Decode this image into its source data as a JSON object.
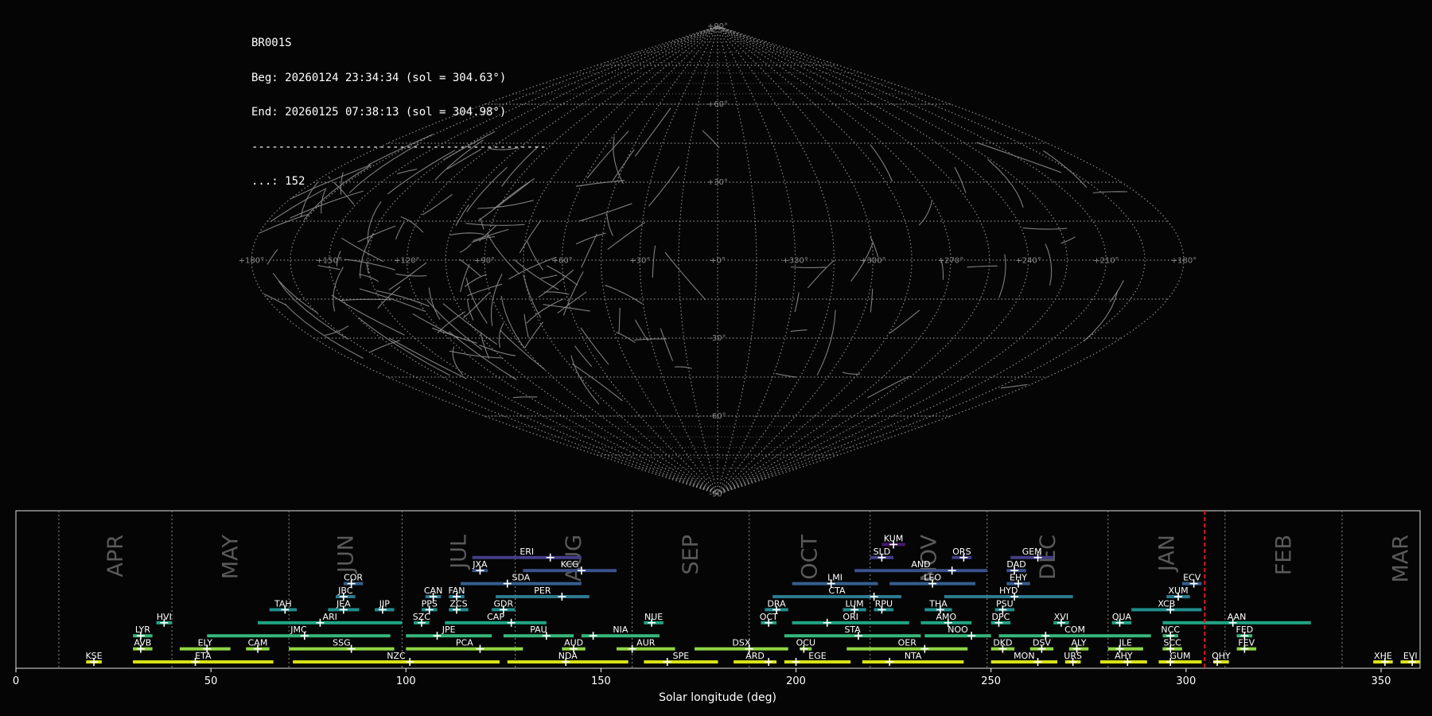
{
  "header": {
    "station": "BR001S",
    "begin": "Beg: 20260124 23:34:34 (sol = 304.63°)",
    "end": "End: 20260125 07:38:13 (sol = 304.98°)",
    "separator": "--------------------------------------------",
    "count": "...: 152"
  },
  "sky_map": {
    "projection": "sinusoidal",
    "lat_labels": [
      "+90°",
      "+60°",
      "+30°",
      "+0°",
      "-30°",
      "-60°",
      "-90°"
    ],
    "lon_labels": [
      "+180°",
      "+150°",
      "+120°",
      "+90°",
      "+60°",
      "+30°",
      "+0°",
      "+330°",
      "+300°",
      "+270°",
      "+240°",
      "+210°",
      "+180°"
    ],
    "grid_color": "#8a8a8a",
    "track_color": "#8c8c8c",
    "track_count": 152
  },
  "chart_data": {
    "type": "range",
    "title": "",
    "xlabel": "Solar longitude (deg)",
    "ylabel": "",
    "xlim": [
      0,
      360
    ],
    "xticks": [
      0,
      50,
      100,
      150,
      200,
      250,
      300,
      350
    ],
    "current_sol": 304.8,
    "current_sol_color": "#e8161a",
    "months": [
      {
        "label": "APR",
        "start": 11,
        "end": 40
      },
      {
        "label": "MAY",
        "start": 40,
        "end": 70
      },
      {
        "label": "JUN",
        "start": 70,
        "end": 99
      },
      {
        "label": "JUL",
        "start": 99,
        "end": 128
      },
      {
        "label": "AUG",
        "start": 128,
        "end": 158
      },
      {
        "label": "SEP",
        "start": 158,
        "end": 188
      },
      {
        "label": "OCT",
        "start": 188,
        "end": 219
      },
      {
        "label": "NOV",
        "start": 219,
        "end": 249
      },
      {
        "label": "DEC",
        "start": 249,
        "end": 280
      },
      {
        "label": "JAN",
        "start": 280,
        "end": 310
      },
      {
        "label": "FEB",
        "start": 310,
        "end": 340
      },
      {
        "label": "MAR",
        "start": 340,
        "end": 371
      }
    ],
    "showers": [
      {
        "code": "KUM",
        "row": 9,
        "start": 222,
        "end": 228,
        "peak": 225
      },
      {
        "code": "ERI",
        "row": 8,
        "start": 117,
        "end": 145,
        "peak": 137
      },
      {
        "code": "SLD",
        "row": 8,
        "start": 219,
        "end": 225,
        "peak": 222
      },
      {
        "code": "ORS",
        "row": 8,
        "start": 240,
        "end": 245,
        "peak": 243
      },
      {
        "code": "GEM",
        "row": 8,
        "start": 255,
        "end": 266,
        "peak": 262
      },
      {
        "code": "JXA",
        "row": 7,
        "start": 117,
        "end": 121,
        "peak": 119
      },
      {
        "code": "KCG",
        "row": 7,
        "start": 130,
        "end": 154,
        "peak": 145
      },
      {
        "code": "AND",
        "row": 7,
        "start": 215,
        "end": 249,
        "peak": 240
      },
      {
        "code": "DAD",
        "row": 7,
        "start": 254,
        "end": 259,
        "peak": 256
      },
      {
        "code": "COR",
        "row": 6,
        "start": 84,
        "end": 89,
        "peak": 86
      },
      {
        "code": "SDA",
        "row": 6,
        "start": 114,
        "end": 145,
        "peak": 126
      },
      {
        "code": "LMI",
        "row": 6,
        "start": 199,
        "end": 221,
        "peak": 209
      },
      {
        "code": "LEO",
        "row": 6,
        "start": 224,
        "end": 246,
        "peak": 235
      },
      {
        "code": "EHY",
        "row": 6,
        "start": 254,
        "end": 260,
        "peak": 257
      },
      {
        "code": "ECV",
        "row": 6,
        "start": 299,
        "end": 304,
        "peak": 302
      },
      {
        "code": "JBC",
        "row": 5,
        "start": 82,
        "end": 87,
        "peak": 84
      },
      {
        "code": "CAN",
        "row": 5,
        "start": 105,
        "end": 109,
        "peak": 107
      },
      {
        "code": "FAN",
        "row": 5,
        "start": 111,
        "end": 115,
        "peak": 113
      },
      {
        "code": "PER",
        "row": 5,
        "start": 123,
        "end": 147,
        "peak": 140
      },
      {
        "code": "CTA",
        "row": 5,
        "start": 194,
        "end": 227,
        "peak": 220
      },
      {
        "code": "HYD",
        "row": 5,
        "start": 238,
        "end": 271,
        "peak": 256
      },
      {
        "code": "XUM",
        "row": 5,
        "start": 295,
        "end": 301,
        "peak": 298
      },
      {
        "code": "TAH",
        "row": 4,
        "start": 65,
        "end": 72,
        "peak": 69
      },
      {
        "code": "JEA",
        "row": 4,
        "start": 80,
        "end": 88,
        "peak": 84
      },
      {
        "code": "JIP",
        "row": 4,
        "start": 92,
        "end": 97,
        "peak": 94
      },
      {
        "code": "PPS",
        "row": 4,
        "start": 104,
        "end": 108,
        "peak": 106
      },
      {
        "code": "ZCS",
        "row": 4,
        "start": 111,
        "end": 116,
        "peak": 113
      },
      {
        "code": "GDR",
        "row": 4,
        "start": 122,
        "end": 128,
        "peak": 125
      },
      {
        "code": "DRA",
        "row": 4,
        "start": 192,
        "end": 198,
        "peak": 195
      },
      {
        "code": "LUM",
        "row": 4,
        "start": 212,
        "end": 218,
        "peak": 215
      },
      {
        "code": "RPU",
        "row": 4,
        "start": 220,
        "end": 225,
        "peak": 222
      },
      {
        "code": "THA",
        "row": 4,
        "start": 233,
        "end": 240,
        "peak": 237
      },
      {
        "code": "PSU",
        "row": 4,
        "start": 251,
        "end": 256,
        "peak": 253
      },
      {
        "code": "XCB",
        "row": 4,
        "start": 286,
        "end": 304,
        "peak": 296
      },
      {
        "code": "HVI",
        "row": 3,
        "start": 36,
        "end": 40,
        "peak": 38
      },
      {
        "code": "ARI",
        "row": 3,
        "start": 62,
        "end": 99,
        "peak": 78
      },
      {
        "code": "SZC",
        "row": 3,
        "start": 102,
        "end": 106,
        "peak": 104
      },
      {
        "code": "CAP",
        "row": 3,
        "start": 110,
        "end": 136,
        "peak": 127
      },
      {
        "code": "NUE",
        "row": 3,
        "start": 161,
        "end": 166,
        "peak": 163
      },
      {
        "code": "OCT",
        "row": 3,
        "start": 191,
        "end": 195,
        "peak": 193
      },
      {
        "code": "ORI",
        "row": 3,
        "start": 199,
        "end": 229,
        "peak": 208
      },
      {
        "code": "AMO",
        "row": 3,
        "start": 232,
        "end": 245,
        "peak": 239
      },
      {
        "code": "DPC",
        "row": 3,
        "start": 250,
        "end": 255,
        "peak": 252
      },
      {
        "code": "XVI",
        "row": 3,
        "start": 266,
        "end": 270,
        "peak": 268
      },
      {
        "code": "QUA",
        "row": 3,
        "start": 281,
        "end": 286,
        "peak": 283
      },
      {
        "code": "AAN",
        "row": 3,
        "start": 294,
        "end": 332,
        "peak": 312
      },
      {
        "code": "LYR",
        "row": 2,
        "start": 30,
        "end": 35,
        "peak": 32
      },
      {
        "code": "JMC",
        "row": 2,
        "start": 49,
        "end": 96,
        "peak": 74
      },
      {
        "code": "JPE",
        "row": 2,
        "start": 100,
        "end": 122,
        "peak": 108
      },
      {
        "code": "PAU",
        "row": 2,
        "start": 125,
        "end": 143,
        "peak": 136
      },
      {
        "code": "NIA",
        "row": 2,
        "start": 145,
        "end": 165,
        "peak": 148
      },
      {
        "code": "STA",
        "row": 2,
        "start": 197,
        "end": 232,
        "peak": 216
      },
      {
        "code": "NOO",
        "row": 2,
        "start": 233,
        "end": 250,
        "peak": 245
      },
      {
        "code": "COM",
        "row": 2,
        "start": 252,
        "end": 291,
        "peak": 264
      },
      {
        "code": "NCC",
        "row": 2,
        "start": 294,
        "end": 298,
        "peak": 296
      },
      {
        "code": "FED",
        "row": 2,
        "start": 313,
        "end": 317,
        "peak": 315
      },
      {
        "code": "AVB",
        "row": 1,
        "start": 30,
        "end": 35,
        "peak": 32
      },
      {
        "code": "ELY",
        "row": 1,
        "start": 42,
        "end": 55,
        "peak": 49
      },
      {
        "code": "CAM",
        "row": 1,
        "start": 59,
        "end": 65,
        "peak": 62
      },
      {
        "code": "SSG",
        "row": 1,
        "start": 70,
        "end": 97,
        "peak": 86
      },
      {
        "code": "PCA",
        "row": 1,
        "start": 100,
        "end": 130,
        "peak": 119
      },
      {
        "code": "AUD",
        "row": 1,
        "start": 140,
        "end": 146,
        "peak": 143
      },
      {
        "code": "AUR",
        "row": 1,
        "start": 154,
        "end": 169,
        "peak": 158
      },
      {
        "code": "DSX",
        "row": 1,
        "start": 174,
        "end": 198,
        "peak": 188
      },
      {
        "code": "OCU",
        "row": 1,
        "start": 201,
        "end": 204,
        "peak": 202
      },
      {
        "code": "OER",
        "row": 1,
        "start": 213,
        "end": 244,
        "peak": 233
      },
      {
        "code": "DKD",
        "row": 1,
        "start": 250,
        "end": 256,
        "peak": 253
      },
      {
        "code": "DSV",
        "row": 1,
        "start": 260,
        "end": 266,
        "peak": 263
      },
      {
        "code": "ALY",
        "row": 1,
        "start": 270,
        "end": 275,
        "peak": 272
      },
      {
        "code": "JLE",
        "row": 1,
        "start": 280,
        "end": 289,
        "peak": 283
      },
      {
        "code": "SCC",
        "row": 1,
        "start": 294,
        "end": 299,
        "peak": 296
      },
      {
        "code": "FEV",
        "row": 1,
        "start": 313,
        "end": 318,
        "peak": 315
      },
      {
        "code": "KSE",
        "row": 0,
        "start": 18,
        "end": 22,
        "peak": 20
      },
      {
        "code": "ETA",
        "row": 0,
        "start": 30,
        "end": 66,
        "peak": 46
      },
      {
        "code": "NZC",
        "row": 0,
        "start": 71,
        "end": 124,
        "peak": 101
      },
      {
        "code": "NDA",
        "row": 0,
        "start": 126,
        "end": 157,
        "peak": 141
      },
      {
        "code": "SPE",
        "row": 0,
        "start": 161,
        "end": 180,
        "peak": 167
      },
      {
        "code": "ARD",
        "row": 0,
        "start": 184,
        "end": 195,
        "peak": 193
      },
      {
        "code": "EGE",
        "row": 0,
        "start": 197,
        "end": 214,
        "peak": 200
      },
      {
        "code": "NTA",
        "row": 0,
        "start": 217,
        "end": 243,
        "peak": 224
      },
      {
        "code": "MON",
        "row": 0,
        "start": 250,
        "end": 267,
        "peak": 262
      },
      {
        "code": "URS",
        "row": 0,
        "start": 269,
        "end": 273,
        "peak": 271
      },
      {
        "code": "AHY",
        "row": 0,
        "start": 278,
        "end": 290,
        "peak": 285
      },
      {
        "code": "GUM",
        "row": 0,
        "start": 293,
        "end": 304,
        "peak": 296
      },
      {
        "code": "OHY",
        "row": 0,
        "start": 307,
        "end": 311,
        "peak": 308
      },
      {
        "code": "XHE",
        "row": 0,
        "start": 348,
        "end": 353,
        "peak": 351
      },
      {
        "code": "EVI",
        "row": 0,
        "start": 355,
        "end": 360,
        "peak": 358
      }
    ]
  }
}
